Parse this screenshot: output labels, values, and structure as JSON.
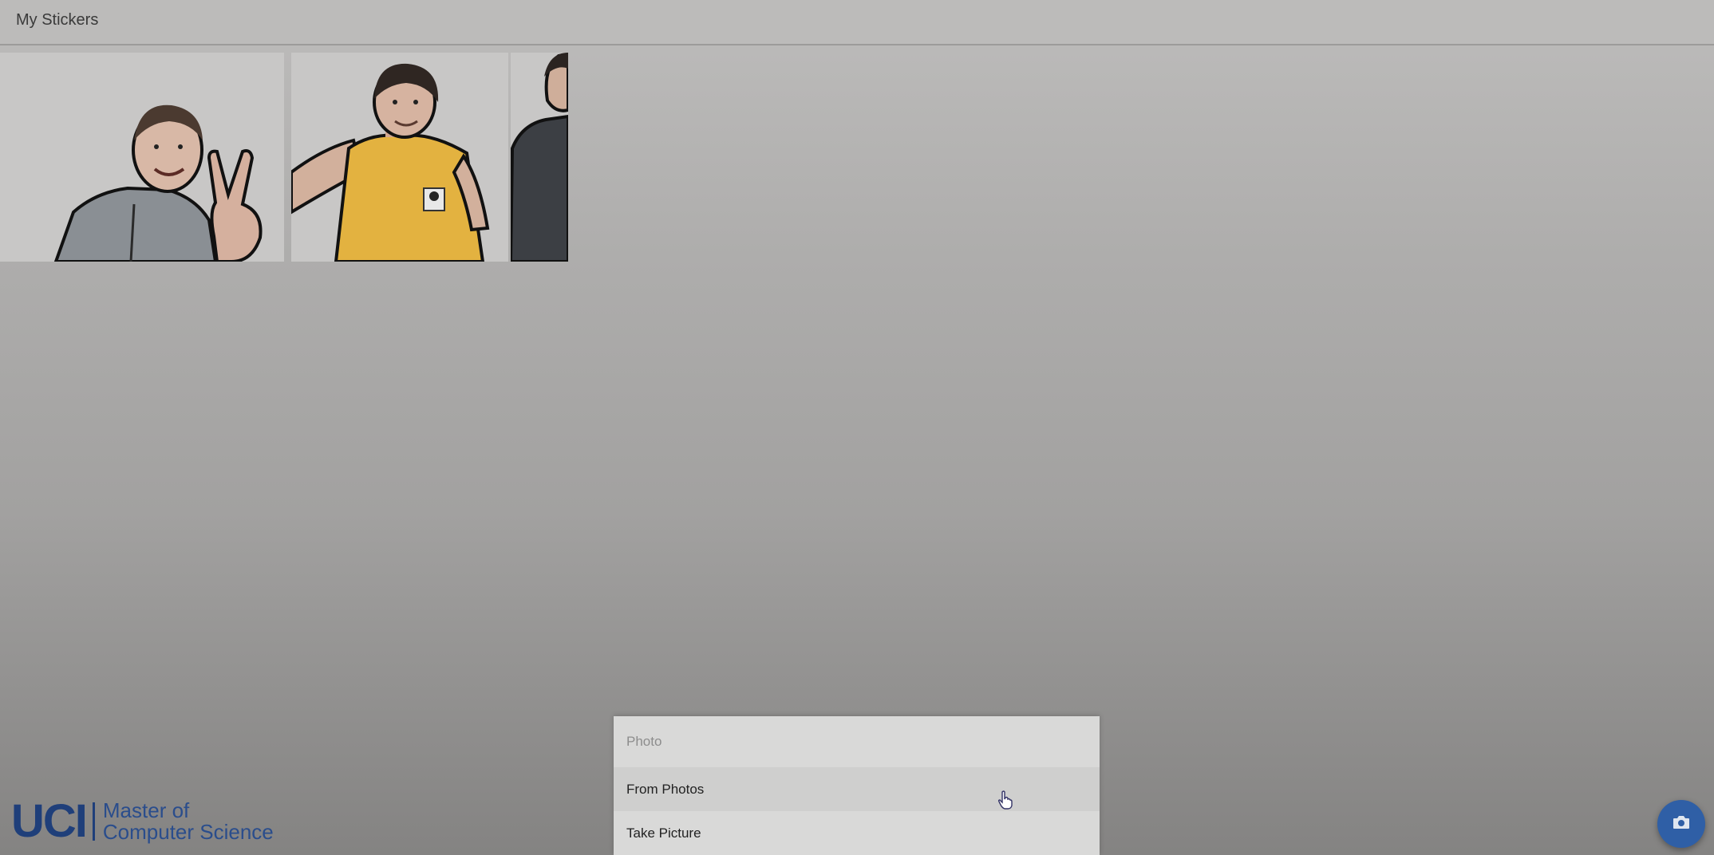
{
  "header": {
    "title": "My Stickers"
  },
  "stickers": [
    {
      "name": "sticker-man-peace-sign"
    },
    {
      "name": "sticker-man-yellow-shirt"
    },
    {
      "name": "sticker-person-partial"
    }
  ],
  "action_sheet": {
    "title": "Photo",
    "items": [
      {
        "label": "From Photos"
      },
      {
        "label": "Take Picture"
      }
    ]
  },
  "branding": {
    "mark": "UCI",
    "line1": "Master of",
    "line2": "Computer Science"
  },
  "fab": {
    "icon": "camera-icon"
  },
  "colors": {
    "accent": "#2f5fa6",
    "brand": "#1f3f7a"
  }
}
